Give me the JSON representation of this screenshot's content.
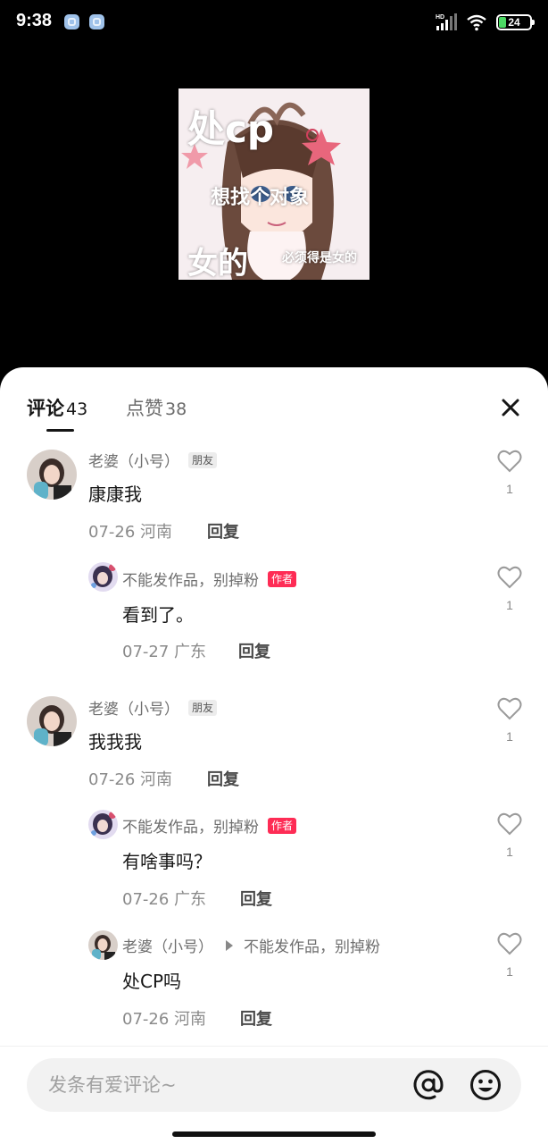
{
  "status_bar": {
    "time": "9:38",
    "battery": "24",
    "network": "HD"
  },
  "artwork": {
    "line1": "处cp",
    "line2": "想找个对象",
    "line3": "女的",
    "line4": "必须得是女的"
  },
  "tabs": {
    "comments_label": "评论",
    "comments_count": "43",
    "likes_label": "点赞",
    "likes_count": "38"
  },
  "comments": [
    {
      "name": "老婆（小号）",
      "badge": "朋友",
      "text": "康康我",
      "date": "07-26",
      "location": "河南",
      "reply": "回复",
      "likes": "1"
    },
    {
      "name": "不能发作品，别掉粉",
      "badge": "作者",
      "text": "看到了。",
      "date": "07-27",
      "location": "广东",
      "reply": "回复",
      "likes": "1"
    },
    {
      "name": "老婆（小号）",
      "badge": "朋友",
      "text": "我我我",
      "date": "07-26",
      "location": "河南",
      "reply": "回复",
      "likes": "1"
    },
    {
      "name": "不能发作品，别掉粉",
      "badge": "作者",
      "text": "有啥事吗？",
      "date": "07-26",
      "location": "广东",
      "reply": "回复",
      "likes": "1"
    },
    {
      "name": "老婆（小号）",
      "reply_to": "不能发作品，别掉粉",
      "text": "处CP吗",
      "date": "07-26",
      "location": "河南",
      "reply": "回复",
      "likes": "1"
    }
  ],
  "input": {
    "placeholder": "发条有爱评论~"
  },
  "colors": {
    "accent": "#fe2c55",
    "friend_badge": "#ececec"
  }
}
